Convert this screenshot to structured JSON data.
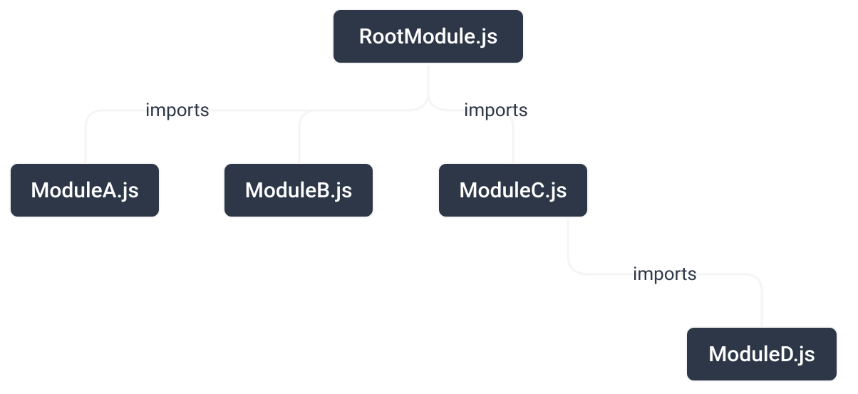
{
  "nodes": {
    "root": "RootModule.js",
    "a": "ModuleA.js",
    "b": "ModuleB.js",
    "c": "ModuleC.js",
    "d": "ModuleD.js"
  },
  "edges": {
    "root_a": "imports",
    "root_c": "imports",
    "c_d": "imports"
  }
}
